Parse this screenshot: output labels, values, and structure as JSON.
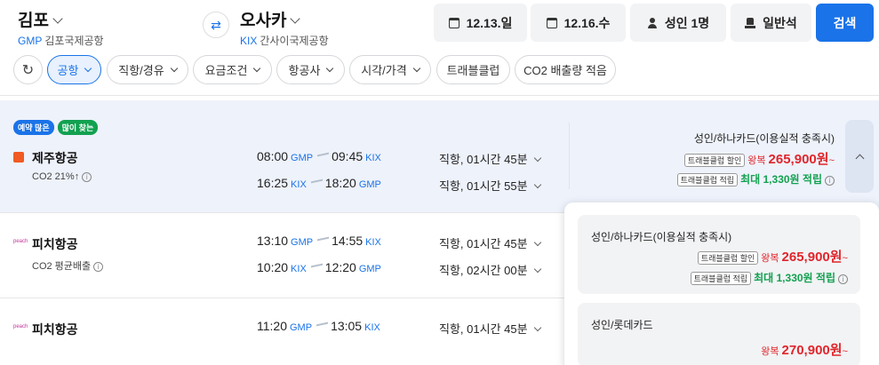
{
  "search": {
    "origin": {
      "city": "김포",
      "code": "GMP",
      "airport": "김포국제공항"
    },
    "destination": {
      "city": "오사카",
      "code": "KIX",
      "airport": "간사이국제공항"
    },
    "depart_date": "12.13.일",
    "return_date": "12.16.수",
    "passengers": "성인 1명",
    "seat_class": "일반석",
    "search_label": "검색"
  },
  "filters": [
    {
      "label": "공항",
      "active": true
    },
    {
      "label": "직항/경유"
    },
    {
      "label": "요금조건"
    },
    {
      "label": "항공사"
    },
    {
      "label": "시각/가격"
    },
    {
      "label": "트래블클럽"
    },
    {
      "label": "CO2 배출량 적음"
    }
  ],
  "results": [
    {
      "badges": [
        "예약 많은",
        "많이 찾는"
      ],
      "airline": "제주항공",
      "co2": "CO2 21%↑",
      "outbound": {
        "dep_time": "08:00",
        "dep_ap": "GMP",
        "arr_time": "09:45",
        "arr_ap": "KIX",
        "duration": "직항, 01시간 45분"
      },
      "inbound": {
        "dep_time": "16:25",
        "dep_ap": "KIX",
        "arr_time": "18:20",
        "arr_ap": "GMP",
        "duration": "직항, 01시간 55분"
      },
      "price": {
        "card": "성인/하나카드(이용실적 충족시)",
        "tag1": "트래블클럽 할인",
        "round": "왕복",
        "fare": "265,900원",
        "tag2": "트래블클럽 적립",
        "points": "최대 1,330원 적립"
      }
    },
    {
      "airline": "피치항공",
      "logo": "peach",
      "co2": "CO2 평균배출",
      "outbound": {
        "dep_time": "13:10",
        "dep_ap": "GMP",
        "arr_time": "14:55",
        "arr_ap": "KIX",
        "duration": "직항, 01시간 45분"
      },
      "inbound": {
        "dep_time": "10:20",
        "dep_ap": "KIX",
        "arr_time": "12:20",
        "arr_ap": "GMP",
        "duration": "직항, 02시간 00분"
      }
    },
    {
      "airline": "피치항공",
      "logo": "peach",
      "outbound": {
        "dep_time": "11:20",
        "dep_ap": "GMP",
        "arr_time": "13:05",
        "arr_ap": "KIX",
        "duration": "직항, 01시간 45분"
      }
    }
  ],
  "price_panel": [
    {
      "card": "성인/하나카드(이용실적 충족시)",
      "tag1": "트래블클럽 할인",
      "round": "왕복",
      "fare": "265,900원",
      "tag2": "트래블클럽 적립",
      "points": "최대 1,330원 적립"
    },
    {
      "card": "성인/롯데카드",
      "round": "왕복",
      "fare": "270,900원"
    }
  ],
  "colors": {
    "accent": "#1a73e8",
    "price": "#e0262c",
    "points": "#12a150"
  }
}
